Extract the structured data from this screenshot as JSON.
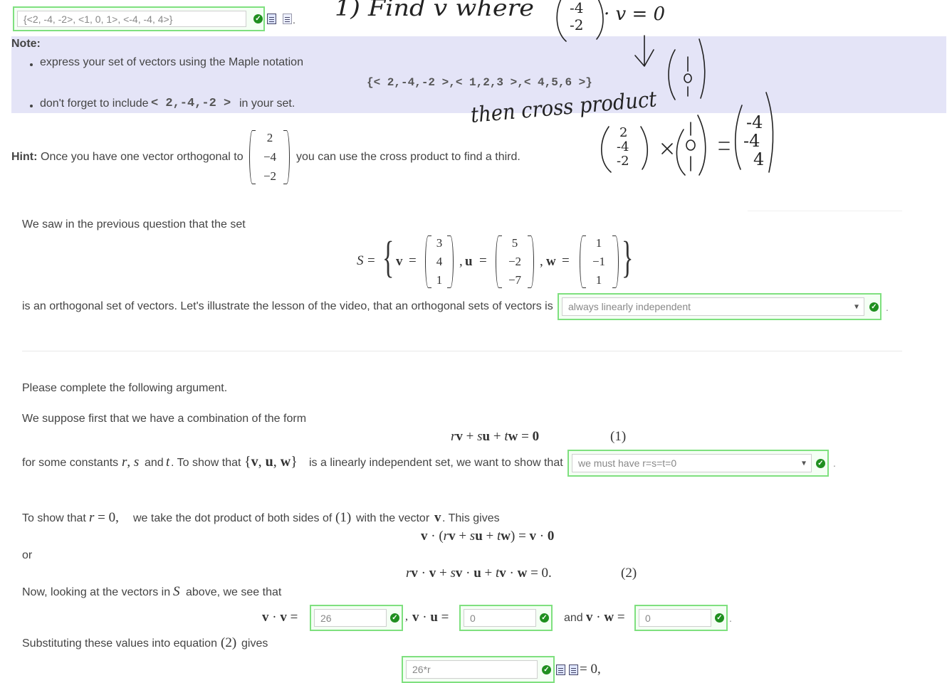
{
  "answer_set_input": "{<2, -4, -2>, <1, 0, 1>, <-4, -4, 4>}",
  "note": {
    "title": "Note:",
    "item1": "express your set of vectors using the Maple notation",
    "example": "{< 2,-4,-2 >,< 1,2,3 >,< 4,5,6 >}",
    "item2_pre": "don't forget to include",
    "item2_vec": "< 2,-4,-2 >",
    "item2_post": "in your set."
  },
  "hint": {
    "label": "Hint:",
    "pre": "Once you have one vector orthogonal to",
    "vector": [
      "2",
      "−4",
      "−2"
    ],
    "post": "you can use the cross product to find a third."
  },
  "section1": {
    "intro": "We saw in the previous question that the set",
    "set_name": "S",
    "v": [
      "3",
      "4",
      "1"
    ],
    "u": [
      "5",
      "−2",
      "−7"
    ],
    "w": [
      "1",
      "−1",
      "1"
    ],
    "orth_text": "is an orthogonal set of vectors. Let's illustrate the lesson of the video, that an orthogonal sets of vectors is",
    "dropdown1": "always linearly independent"
  },
  "section2": {
    "p1": "Please complete the following argument.",
    "p2": "We suppose first that we have a combination of the form",
    "eq1": "rv + su + tw = 0",
    "eq1_tag": "(1)",
    "p3_pre": "for some constants",
    "p3_mid1": "and",
    "p3_mid2": ". To show that",
    "p3_post": "is a linearly independent set, we want to show that",
    "dropdown2": "we must have r=s=t=0",
    "p4_pre": "To show that",
    "p4_mid": "we take the dot product of both sides of",
    "p4_post": "with the vector",
    "p4_end": ". This gives",
    "or": "or",
    "eq2_tag": "(2)",
    "p5_pre": "Now, looking at the vectors in",
    "p5_post": "above, we see that",
    "vv_value": "26",
    "vu_value": "0",
    "and": "and",
    "vw_value": "0",
    "p6_pre": "Substituting these values into equation",
    "p6_post": "gives",
    "subst_value": "26*r",
    "subst_tail": "= 0,"
  },
  "handwriting": {
    "line1": "1) Find v where",
    "line2": "then cross product"
  }
}
